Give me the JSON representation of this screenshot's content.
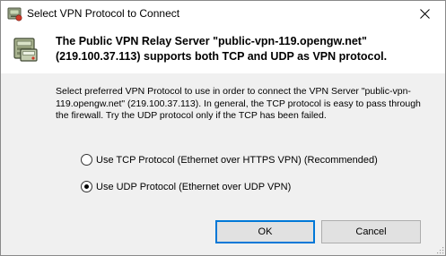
{
  "window": {
    "title": "Select VPN Protocol to Connect",
    "title_icon": "vpn-client-icon",
    "close_icon": "close-icon"
  },
  "header": {
    "icon": "vpn-server-icon",
    "text": "The Public VPN Relay Server \"public-vpn-119.opengw.net\" (219.100.37.113) supports both TCP and UDP as VPN protocol."
  },
  "description": "Select preferred VPN Protocol to use in order to connect the VPN Server \"public-vpn-119.opengw.net\" (219.100.37.113). In general, the TCP protocol is easy to pass through the firewall. Try the UDP protocol only if the TCP has been failed.",
  "options": [
    {
      "label": "Use TCP Protocol (Ethernet over HTTPS VPN) (Recommended)",
      "selected": false
    },
    {
      "label": "Use UDP Protocol (Ethernet over UDP VPN)",
      "selected": true
    }
  ],
  "buttons": {
    "ok": "OK",
    "cancel": "Cancel"
  },
  "colors": {
    "dialog_background": "#f0f0f0",
    "header_background": "#ffffff",
    "default_button_border": "#0078d7"
  }
}
